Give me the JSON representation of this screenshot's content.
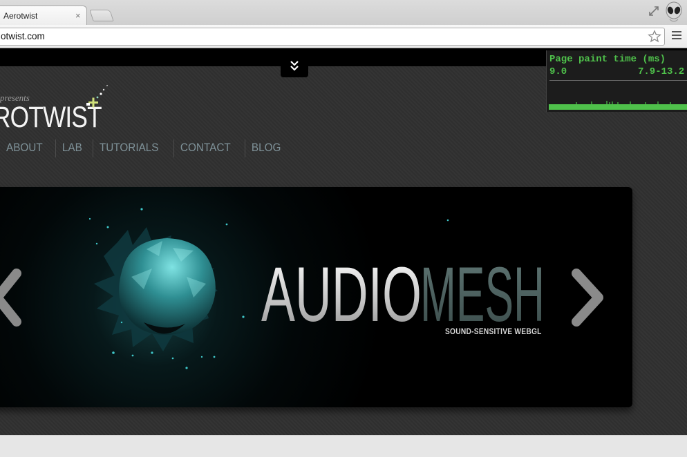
{
  "browser": {
    "tab_title": "Aerotwist",
    "tab_close": "×",
    "url": "otwist.com"
  },
  "site": {
    "presents": "presents",
    "logo": "ROTWIST",
    "nav": [
      "ABOUT",
      "LAB",
      "TUTORIALS",
      "CONTACT",
      "BLOG"
    ]
  },
  "banner": {
    "title_part1": "AUDIO",
    "title_part2": "MESH",
    "subtitle": "SOUND-SENSITIVE WEBGL"
  },
  "perf_overlay": {
    "title": "Page paint time (ms)",
    "current": "9.0",
    "range": "7.9-13.2"
  },
  "colors": {
    "perf_green": "#4fc14b",
    "nav_text": "#7f9299",
    "accent_teal": "#3fc7c9"
  },
  "icons": [
    "close-icon",
    "fullscreen-icon",
    "star-icon",
    "menu-icon",
    "chevron-double-down-icon",
    "chevron-left-icon",
    "chevron-right-icon"
  ]
}
